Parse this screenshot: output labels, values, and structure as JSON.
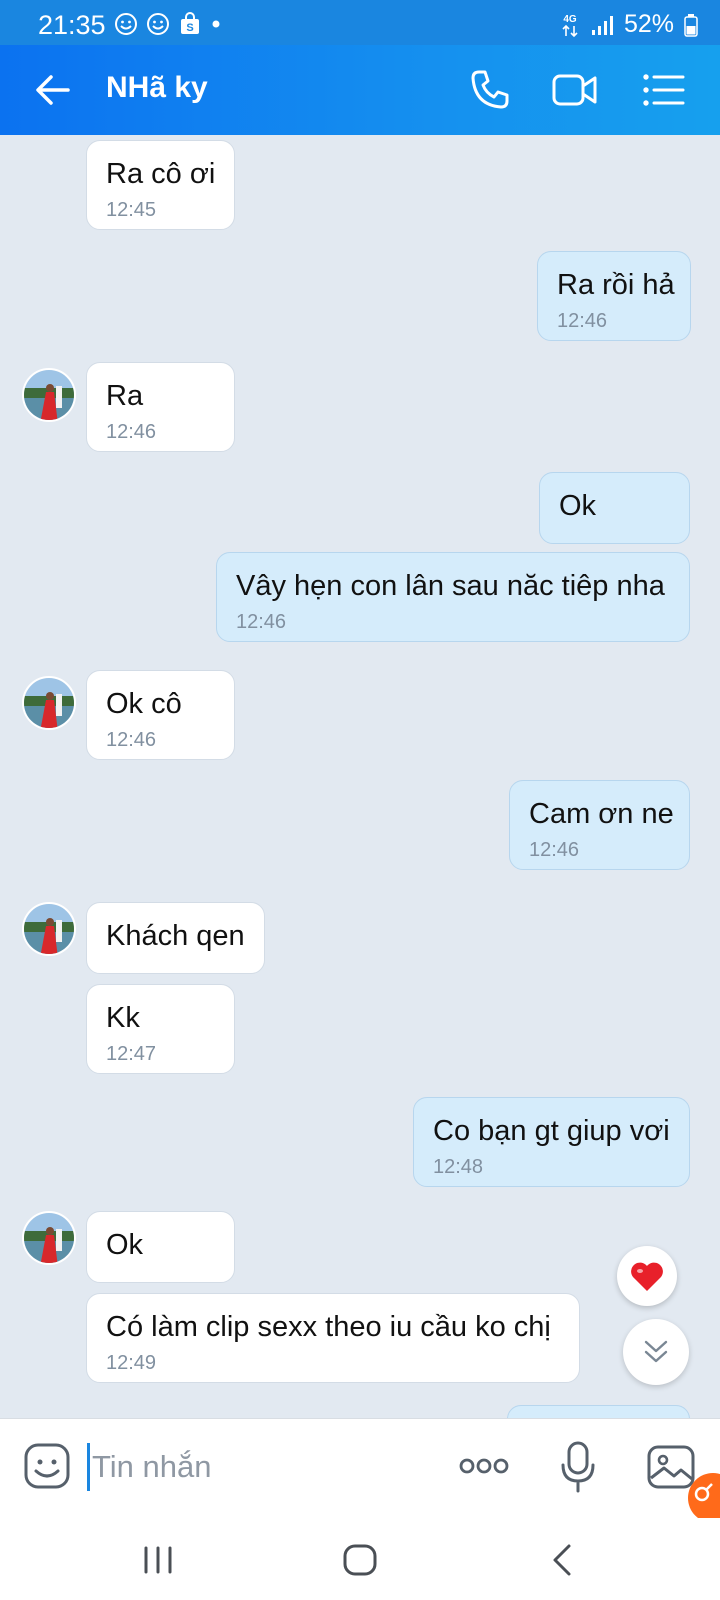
{
  "status_bar": {
    "time": "21:35",
    "network": "4G",
    "battery": "52%"
  },
  "header": {
    "title": "NHã ky"
  },
  "messages": [
    {
      "side": "in",
      "text": "Ra cô ơi",
      "time": "12:45"
    },
    {
      "side": "out",
      "text": "Ra rồi hả",
      "time": "12:46"
    },
    {
      "side": "in",
      "text": "Ra",
      "time": "12:46"
    },
    {
      "side": "out",
      "text": "Ok",
      "time": ""
    },
    {
      "side": "out",
      "text": "Vây hẹn con lân sau năc tiêp nha",
      "time": "12:46"
    },
    {
      "side": "in",
      "text": "Ok cô",
      "time": "12:46"
    },
    {
      "side": "out",
      "text": "Cam ơn ne",
      "time": "12:46"
    },
    {
      "side": "in",
      "text": "Khách qen",
      "time": ""
    },
    {
      "side": "in",
      "text": "Kk",
      "time": "12:47"
    },
    {
      "side": "out",
      "text": "Co bạn gt giup vơi",
      "time": "12:48"
    },
    {
      "side": "in",
      "text": "Ok",
      "time": ""
    },
    {
      "side": "in",
      "text": "Có làm clip sexx theo iu cầu ko chị",
      "time": "12:49"
    }
  ],
  "input": {
    "placeholder": "Tin nhắn"
  },
  "icons": {
    "back": "arrow-left-icon",
    "call": "phone-icon",
    "video": "video-camera-icon",
    "menu": "list-menu-icon",
    "emoji": "emoji-icon",
    "more": "more-dots-icon",
    "mic": "microphone-icon",
    "image": "image-icon",
    "heart": "heart-icon",
    "scroll_down": "double-chevron-down-icon"
  },
  "colors": {
    "header": "#1590ef",
    "outgoing_bubble": "#d5ecfb",
    "incoming_bubble": "#ffffff",
    "background": "#e2e9f1",
    "heart": "#e8202a"
  }
}
